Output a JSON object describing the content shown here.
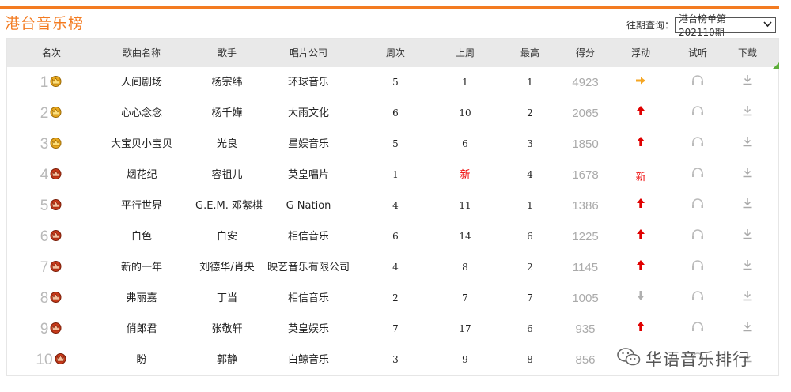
{
  "page": {
    "title": "港台音乐榜"
  },
  "period": {
    "label": "往期查询：",
    "selected": "港台榜单第202110期"
  },
  "columns": [
    "名次",
    "歌曲名称",
    "歌手",
    "唱片公司",
    "周次",
    "上周",
    "最高",
    "得分",
    "浮动",
    "试听",
    "下载"
  ],
  "rows": [
    {
      "rank": "1",
      "song": "人间剧场",
      "artist": "杨宗纬",
      "company": "环球音乐",
      "weeks": "5",
      "last": "1",
      "peak": "1",
      "score": "4923",
      "trend": "same",
      "crown": "gold"
    },
    {
      "rank": "2",
      "song": "心心念念",
      "artist": "杨千嬅",
      "company": "大雨文化",
      "weeks": "6",
      "last": "10",
      "peak": "2",
      "score": "2065",
      "trend": "up",
      "crown": "gold"
    },
    {
      "rank": "3",
      "song": "大宝贝小宝贝",
      "artist": "光良",
      "company": "星娱音乐",
      "weeks": "5",
      "last": "6",
      "peak": "3",
      "score": "1850",
      "trend": "up",
      "crown": "gold"
    },
    {
      "rank": "4",
      "song": "烟花纪",
      "artist": "容祖儿",
      "company": "英皇唱片",
      "weeks": "1",
      "last": "新",
      "peak": "4",
      "score": "1678",
      "trend": "new",
      "crown": "red"
    },
    {
      "rank": "5",
      "song": "平行世界",
      "artist": "G.E.M. 邓紫棋",
      "company": "G Nation",
      "weeks": "4",
      "last": "11",
      "peak": "1",
      "score": "1386",
      "trend": "up",
      "crown": "red"
    },
    {
      "rank": "6",
      "song": "白色",
      "artist": "白安",
      "company": "相信音乐",
      "weeks": "6",
      "last": "14",
      "peak": "6",
      "score": "1225",
      "trend": "up",
      "crown": "red"
    },
    {
      "rank": "7",
      "song": "新的一年",
      "artist": "刘德华/肖央",
      "company": "映艺音乐有限公司",
      "weeks": "4",
      "last": "8",
      "peak": "2",
      "score": "1145",
      "trend": "up",
      "crown": "red"
    },
    {
      "rank": "8",
      "song": "弗丽嘉",
      "artist": "丁当",
      "company": "相信音乐",
      "weeks": "2",
      "last": "7",
      "peak": "7",
      "score": "1005",
      "trend": "down",
      "crown": "red"
    },
    {
      "rank": "9",
      "song": "俏郎君",
      "artist": "张敬轩",
      "company": "英皇娱乐",
      "weeks": "7",
      "last": "17",
      "peak": "6",
      "score": "935",
      "trend": "up",
      "crown": "red"
    },
    {
      "rank": "10",
      "song": "盼",
      "artist": "郭静",
      "company": "白鲸音乐",
      "weeks": "3",
      "last": "9",
      "peak": "8",
      "score": "856",
      "trend": "",
      "crown": "red"
    }
  ],
  "trend_new_label": "新",
  "watermark": {
    "text": "华语音乐排行"
  },
  "colors": {
    "accent": "#f37b21",
    "up": "#e00000",
    "same": "#f5a623",
    "down": "#b0b0b0",
    "header_bg": "#e9e9e9",
    "corner": "#5cae3a"
  }
}
